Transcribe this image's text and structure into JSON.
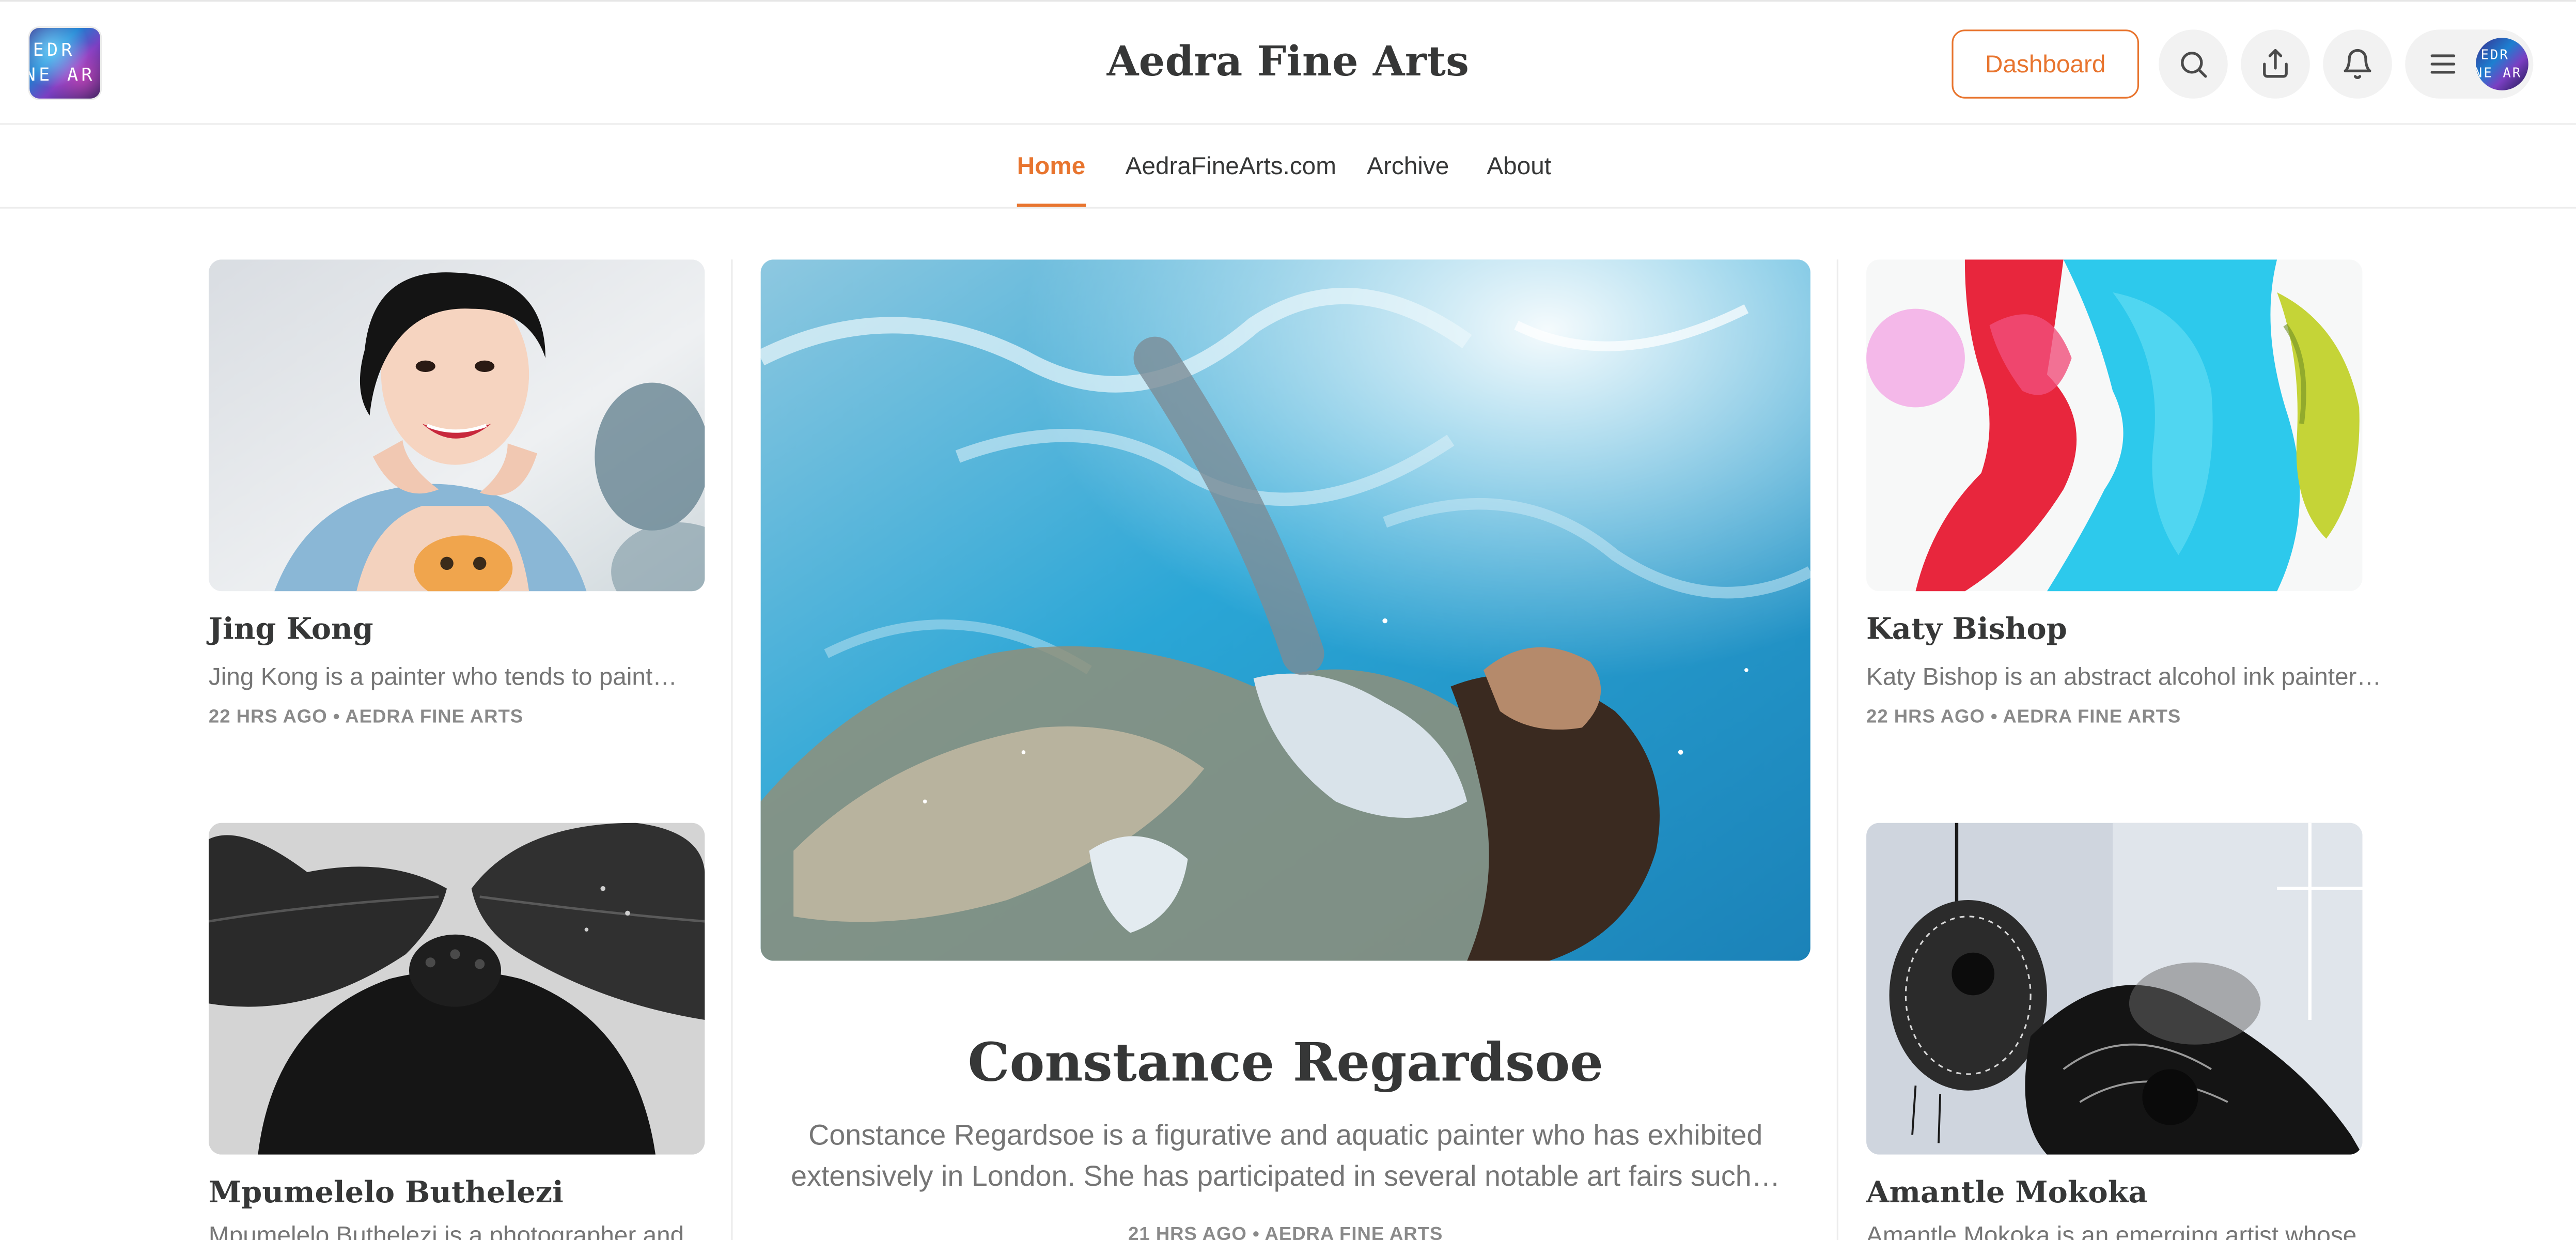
{
  "header": {
    "logo_text_line1": "EDR",
    "logo_text_line2": "NE AR",
    "site_title": "Aedra Fine Arts",
    "dashboard_label": "Dashboard",
    "icons": [
      "search-icon",
      "share-icon",
      "bell-icon",
      "menu-icon"
    ],
    "avatar_text_line1": "EDR",
    "avatar_text_line2": "NE AR"
  },
  "nav": {
    "items": [
      {
        "label": "Home",
        "active": true
      },
      {
        "label": "AedraFineArts.com",
        "active": false
      },
      {
        "label": "Archive",
        "active": false
      },
      {
        "label": "About",
        "active": false
      }
    ]
  },
  "featured": {
    "title": "Constance Regardsoe",
    "subtitle": "Constance Regardsoe is a figurative and aquatic painter who has exhibited extensively in London. She has participated in several notable art fairs such…",
    "meta": "21 HRS AGO • AEDRA FINE ARTS"
  },
  "left_posts": [
    {
      "title": "Jing Kong",
      "subtitle": "Jing Kong is a painter who tends to paint…",
      "meta": "22 HRS AGO • AEDRA FINE ARTS"
    },
    {
      "title": "Mpumelelo Buthelezi",
      "subtitle": "Mpumelelo Buthelezi is a photographer and…"
    }
  ],
  "right_posts": [
    {
      "title": "Katy Bishop",
      "subtitle": "Katy Bishop is an abstract alcohol ink painter…",
      "meta": "22 HRS AGO • AEDRA FINE ARTS"
    },
    {
      "title": "Amantle Mokoka",
      "subtitle": "Amantle Mokoka is an emerging artist whose…"
    }
  ],
  "colors": {
    "accent": "#e8752f",
    "text": "#363737",
    "muted": "#757575",
    "meta": "#8a8a8a",
    "border": "#ececec"
  }
}
